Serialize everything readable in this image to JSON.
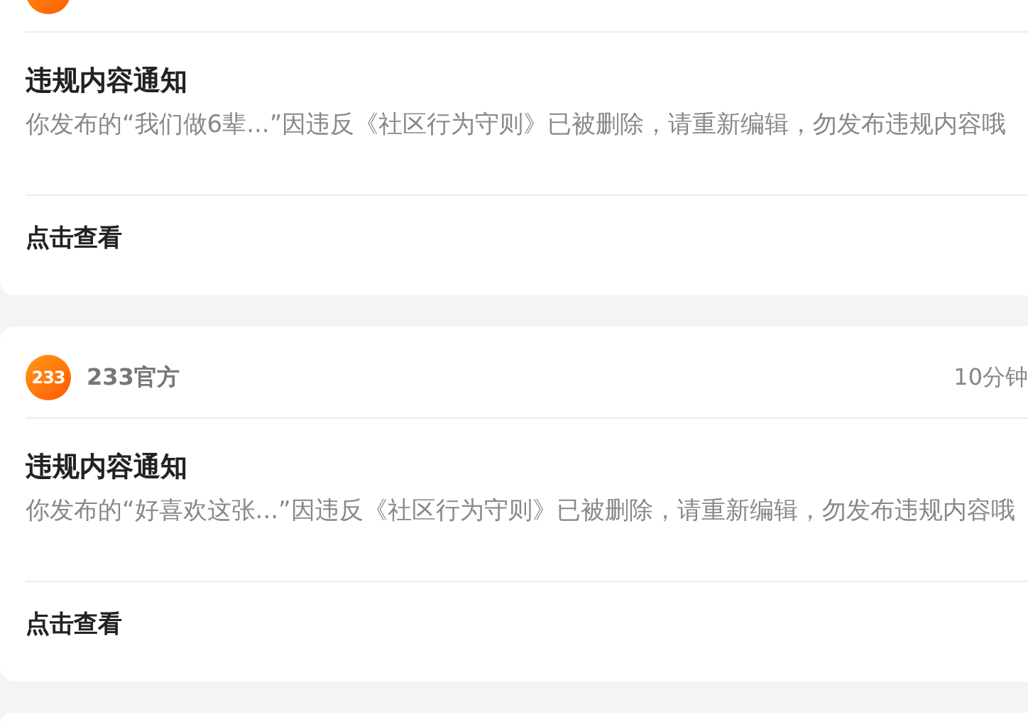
{
  "notifications": [
    {
      "title": "违规内容通知",
      "message": "你发布的“我们做6辈...”因违反《社区行为守则》已被删除，请重新编辑，勿发布违规内容哦",
      "action": "点击查看"
    },
    {
      "sender": {
        "avatar_text": "233",
        "name": "233官方",
        "time": "10分钟"
      },
      "title": "违规内容通知",
      "message": "你发布的“好喜欢这张...”因违反《社区行为守则》已被删除，请重新编辑，勿发布违规内容哦",
      "action": "点击查看"
    }
  ]
}
